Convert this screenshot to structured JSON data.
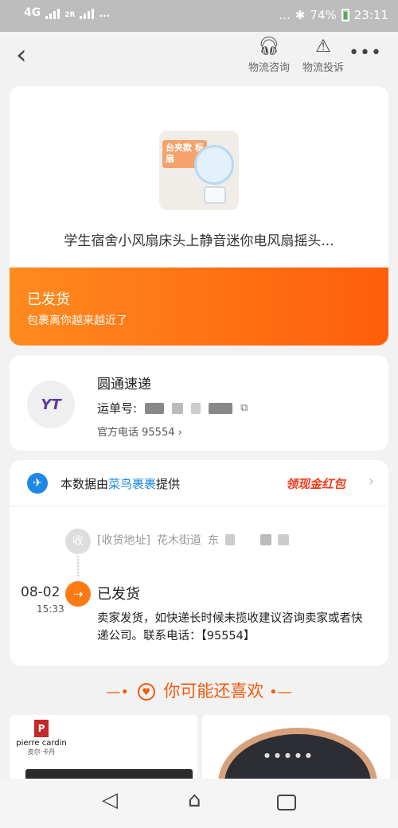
{
  "status_bar": {
    "network": "4G",
    "network2": "2R",
    "sim_badge": "1",
    "dots_left": "...",
    "dots_right": "...",
    "bluetooth_icon": "bluetooth-icon",
    "battery": "74%",
    "time": "23:11"
  },
  "nav": {
    "back_icon": "chevron-left-icon",
    "consult": {
      "icon": "headset-icon",
      "label": "物流咨询"
    },
    "complaint": {
      "icon": "warning-icon",
      "label": "物流投诉"
    },
    "more_icon": "more-icon"
  },
  "product": {
    "thumb_tag": "台夹款 标扇",
    "title": "学生宿舍小风扇床头上静音迷你电风扇摇头...",
    "status": "已发货",
    "status_sub": "包裹离你越来越近了"
  },
  "courier": {
    "logo_text": "YT",
    "name": "圆通速递",
    "tracking_label": "运单号:",
    "phone_label": "官方电话 95554 ›"
  },
  "tracking": {
    "provider_prefix": "本数据由",
    "provider_name": "菜鸟裹裹",
    "provider_suffix": "提供",
    "red_packet": "领现金红包",
    "receive_badge": "收",
    "address_label": "[收货地址]",
    "address_text": "花木街道",
    "address_char": "东",
    "event": {
      "date": "08-02",
      "time": "15:33",
      "status": "已发货",
      "description": "卖家发货，如快递长时候未揽收建议咨询卖家或者快递公司。联系电话：【95554】"
    }
  },
  "recommend": {
    "title": "你可能还喜欢",
    "items": [
      {
        "brand": "pierre cardin",
        "brand_sub": "皮尔·卡丹"
      },
      {
        "brand": ""
      }
    ]
  },
  "colors": {
    "accent": "#ff6a12",
    "link": "#1e88e5",
    "red": "#f23a1b"
  }
}
